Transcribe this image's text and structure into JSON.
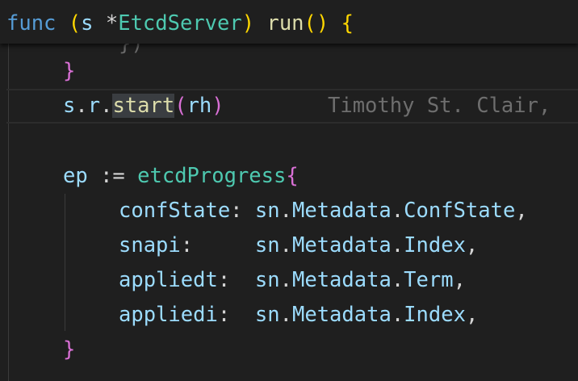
{
  "sticky_scroll": {
    "kw_func": "func",
    "paren_open": "(",
    "receiver": "s",
    "star": "*",
    "receiver_type": "EtcdServer",
    "paren_close": ")",
    "method": "run",
    "call_parens": "()",
    "brace": "{"
  },
  "editor": {
    "ghost_fragment": "})",
    "close_brace_1": "}",
    "start_line": {
      "s": "s",
      "dot1": ".",
      "r": "r",
      "dot2": ".",
      "fn": "start",
      "paren_open": "(",
      "arg": "rh",
      "paren_close": ")"
    },
    "blame": "Timothy St. Clair,",
    "ep_line": {
      "var": "ep",
      "op": " := ",
      "type": "etcdProgress",
      "brace": "{"
    },
    "fields": [
      {
        "name": "confState",
        "colon": ":",
        "pad": " ",
        "obj": "sn",
        "d1": ".",
        "mid": "Metadata",
        "d2": ".",
        "leaf": "ConfState",
        "comma": ","
      },
      {
        "name": "snapi",
        "colon": ":",
        "pad": "     ",
        "obj": "sn",
        "d1": ".",
        "mid": "Metadata",
        "d2": ".",
        "leaf": "Index",
        "comma": ","
      },
      {
        "name": "appliedt",
        "colon": ":",
        "pad": "  ",
        "obj": "sn",
        "d1": ".",
        "mid": "Metadata",
        "d2": ".",
        "leaf": "Term",
        "comma": ","
      },
      {
        "name": "appliedi",
        "colon": ":",
        "pad": "  ",
        "obj": "sn",
        "d1": ".",
        "mid": "Metadata",
        "d2": ".",
        "leaf": "Index",
        "comma": ","
      }
    ],
    "close_brace_2": "}"
  },
  "colors": {
    "background": "#1f1f1f",
    "keyword": "#569cd6",
    "variable": "#9cdcfe",
    "type": "#4ec9b0",
    "function": "#dcdcaa",
    "bracket_gold": "#ffd700",
    "bracket_orchid": "#da70d6",
    "bracket_blue": "#179fff"
  }
}
